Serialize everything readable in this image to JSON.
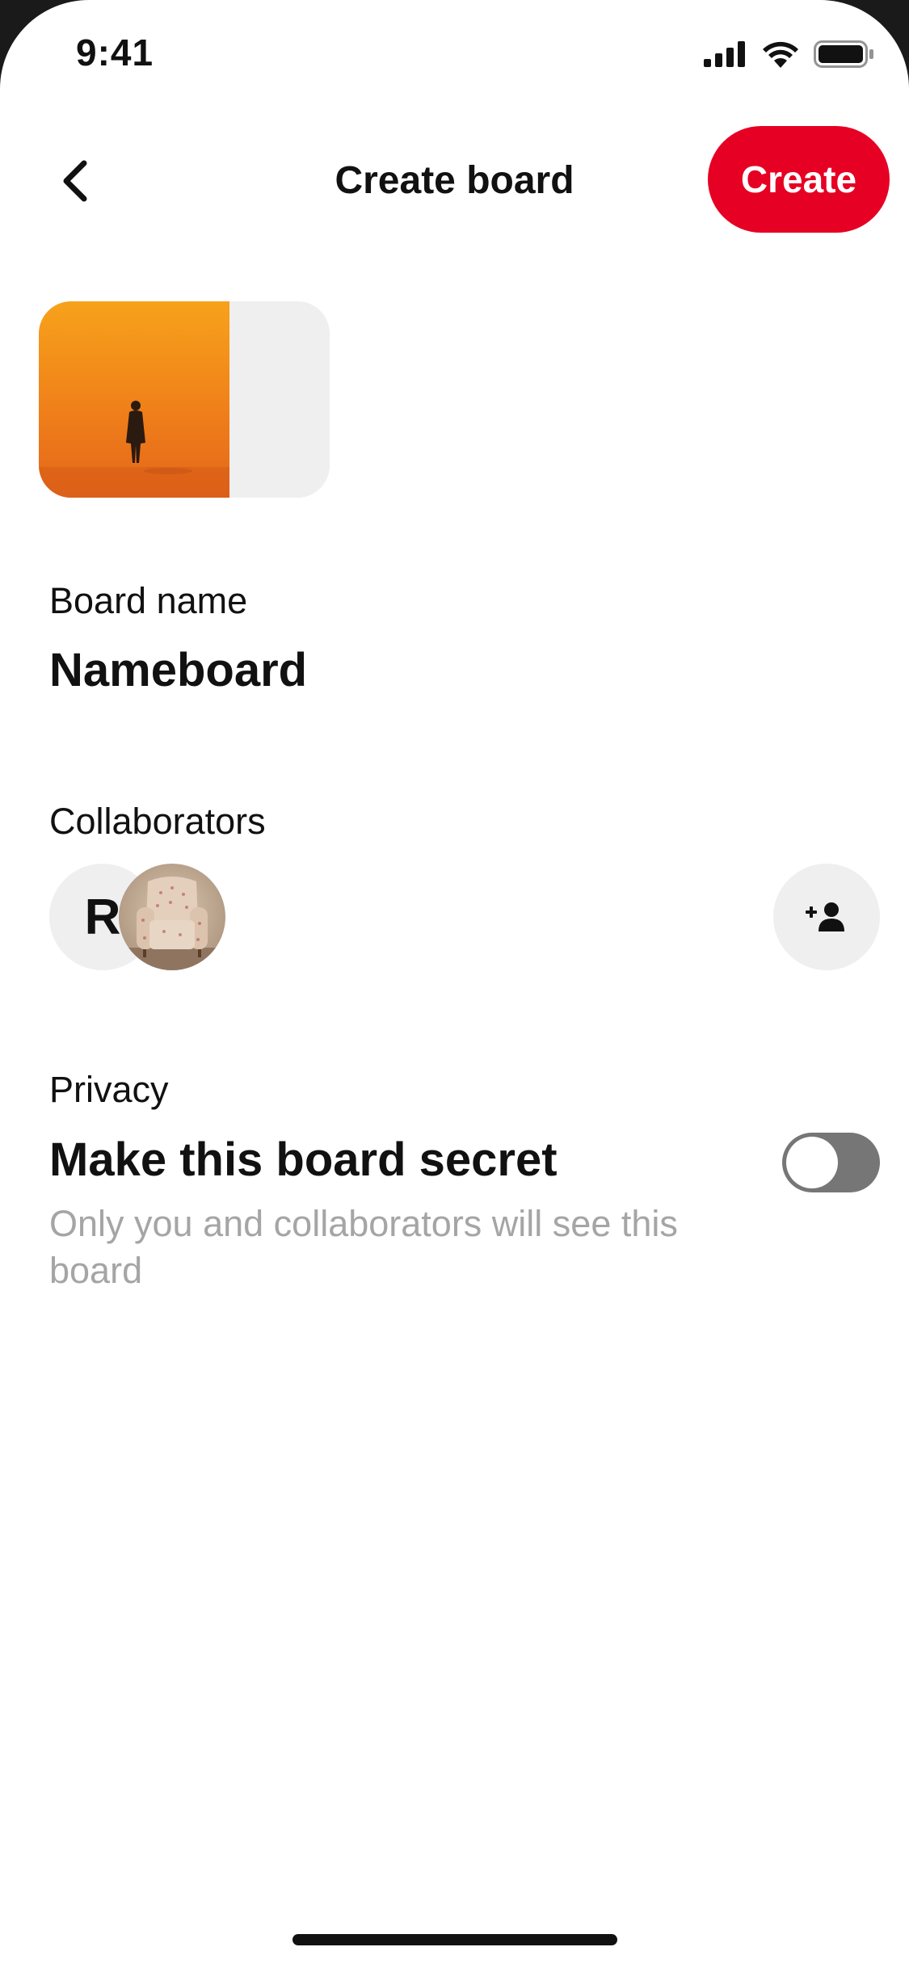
{
  "status_bar": {
    "time": "9:41",
    "icons": [
      "signal-icon",
      "wifi-icon",
      "battery-icon"
    ]
  },
  "header": {
    "title": "Create board",
    "back_icon": "chevron-left-icon",
    "create_label": "Create",
    "accent_color": "#e60023"
  },
  "cover": {
    "main_image": "orange-desert-silhouette",
    "placeholder_tiles": 2
  },
  "board_name": {
    "label": "Board name",
    "value": "Nameboard"
  },
  "collaborators": {
    "label": "Collaborators",
    "avatars": [
      {
        "type": "initial",
        "initial": "R"
      },
      {
        "type": "photo",
        "description": "armchair"
      }
    ],
    "add_icon": "add-person-icon"
  },
  "privacy": {
    "label": "Privacy",
    "title": "Make this board secret",
    "description": "Only you and collaborators will see this board",
    "secret_enabled": false
  }
}
